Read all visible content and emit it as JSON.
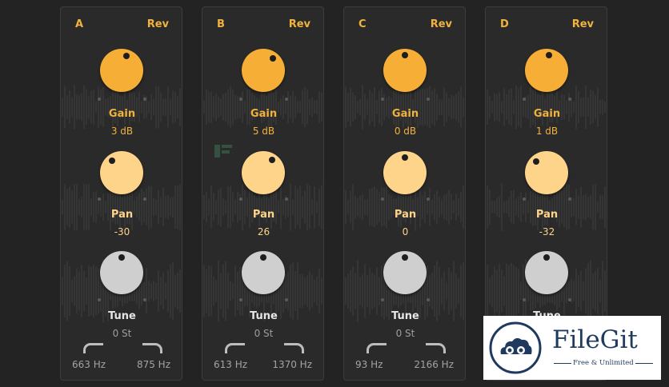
{
  "colors": {
    "gain_knob": "#f6ae36",
    "pan_knob": "#fdd48a",
    "tune_knob": "#cfcfcf",
    "gain_text": "#f1b23e",
    "pan_text": "#fdd48a",
    "tune_text": "#d3d3d3"
  },
  "channels": [
    {
      "letter": "A",
      "rev_label": "Rev",
      "gain": {
        "label": "Gain",
        "value": "3 dB",
        "dot_angle": 20
      },
      "pan": {
        "label": "Pan",
        "value": "-30",
        "dot_angle": -40
      },
      "tune": {
        "label": "Tune",
        "value": "0 St",
        "dot_angle": 0
      },
      "filter": {
        "low": "663 Hz",
        "high": "875 Hz"
      }
    },
    {
      "letter": "B",
      "rev_label": "Rev",
      "gain": {
        "label": "Gain",
        "value": "5 dB",
        "dot_angle": 40
      },
      "pan": {
        "label": "Pan",
        "value": "26",
        "dot_angle": 35
      },
      "tune": {
        "label": "Tune",
        "value": "0 St",
        "dot_angle": 0
      },
      "filter": {
        "low": "613 Hz",
        "high": "1370 Hz"
      }
    },
    {
      "letter": "C",
      "rev_label": "Rev",
      "gain": {
        "label": "Gain",
        "value": "0 dB",
        "dot_angle": 0
      },
      "pan": {
        "label": "Pan",
        "value": "0",
        "dot_angle": 0
      },
      "tune": {
        "label": "Tune",
        "value": "0 St",
        "dot_angle": 0
      },
      "filter": {
        "low": "93 Hz",
        "high": "2166 Hz"
      }
    },
    {
      "letter": "D",
      "rev_label": "Rev",
      "gain": {
        "label": "Gain",
        "value": "1 dB",
        "dot_angle": 8
      },
      "pan": {
        "label": "Pan",
        "value": "-32",
        "dot_angle": -42
      },
      "tune": {
        "label": "Tune",
        "value": "",
        "dot_angle": 0
      },
      "filter": {
        "low": "",
        "high": ""
      }
    }
  ],
  "watermark_filecr": {
    "icon": "filecr-logo-icon"
  },
  "watermark_filegit": {
    "brand": "FileGit",
    "tagline": "Free & Unlimited",
    "icon": "cloud-logo-icon"
  }
}
